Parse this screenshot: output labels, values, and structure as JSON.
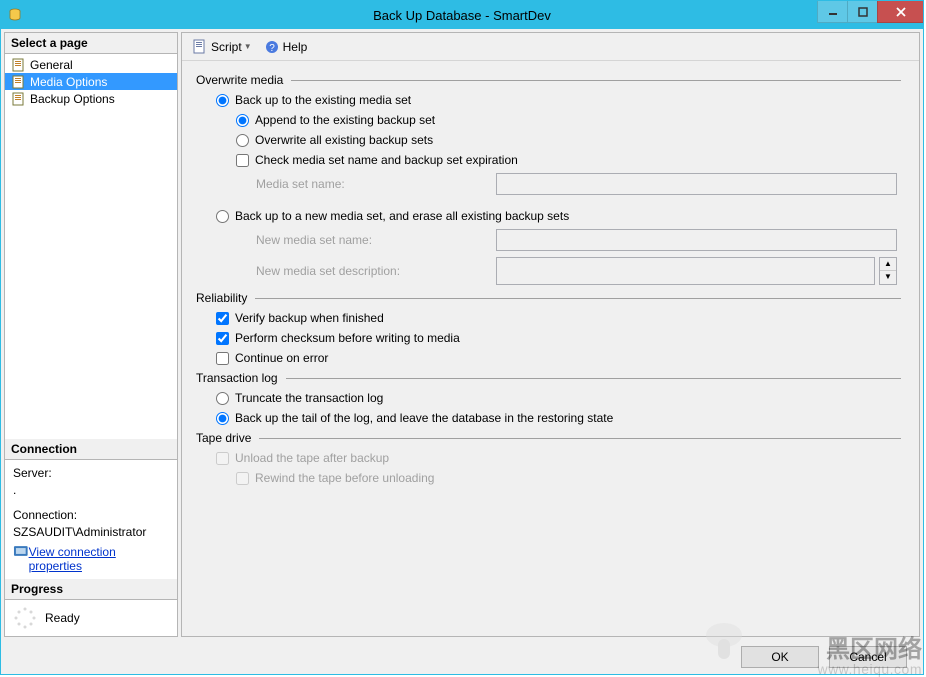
{
  "window": {
    "title": "Back Up Database - SmartDev"
  },
  "sidebar": {
    "select_a_page": "Select a page",
    "pages": {
      "general": "General",
      "media_options": "Media Options",
      "backup_options": "Backup Options"
    },
    "connection_header": "Connection",
    "server_label": "Server:",
    "server_value": ".",
    "connection_label": "Connection:",
    "connection_value": "SZSAUDIT\\Administrator",
    "view_props": "View connection properties",
    "progress_header": "Progress",
    "progress_status": "Ready"
  },
  "toolbar": {
    "script": "Script",
    "help": "Help"
  },
  "overwrite": {
    "group": "Overwrite media",
    "existing": "Back up to the existing media set",
    "append": "Append to the existing backup set",
    "overwrite_all": "Overwrite all existing backup sets",
    "check_media": "Check media set name and backup set expiration",
    "media_set_name": "Media set name:",
    "new_set": "Back up to a new media set, and erase all existing backup sets",
    "new_media_set_name": "New media set name:",
    "new_media_set_desc": "New media set description:"
  },
  "reliability": {
    "group": "Reliability",
    "verify": "Verify backup when finished",
    "checksum": "Perform checksum before writing to media",
    "continue": "Continue on error"
  },
  "tlog": {
    "group": "Transaction log",
    "truncate": "Truncate the transaction log",
    "backup_tail": "Back up the tail of the log, and leave the database in the restoring state"
  },
  "tape": {
    "group": "Tape drive",
    "unload": "Unload the tape after backup",
    "rewind": "Rewind the tape before unloading"
  },
  "buttons": {
    "ok": "OK",
    "cancel": "Cancel"
  },
  "watermark": {
    "line1": "黑区网络",
    "line2": "www.heiqu.com"
  }
}
